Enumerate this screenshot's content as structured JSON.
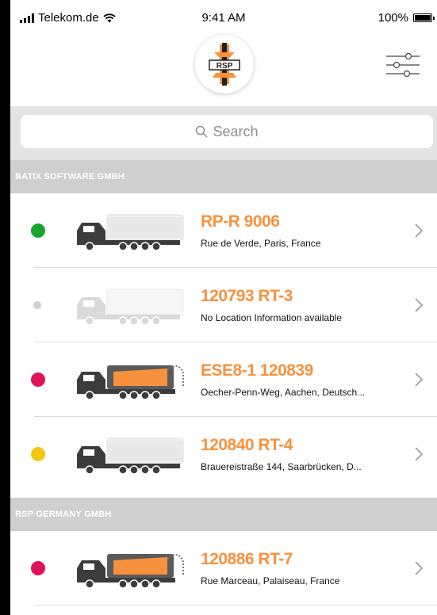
{
  "status_bar": {
    "carrier": "Telekom.de",
    "time": "9:41 AM",
    "battery": "100%"
  },
  "header": {
    "logo_text": "RSP",
    "filter_icon": "sliders-icon"
  },
  "search": {
    "placeholder": "Search",
    "icon": "magnifier-icon"
  },
  "colors": {
    "accent": "#f7913d",
    "online": "#17a52c",
    "offline": "#d1d1d1",
    "alert": "#e0135a",
    "warning": "#f2c80f"
  },
  "groups": [
    {
      "name": "BATIX SOFTWARE GMBH",
      "vehicles": [
        {
          "plate": "RP-R 9006",
          "location": "Rue de Verde, Paris, France",
          "status_color": "#17a52c"
        },
        {
          "plate": "120793 RT-3",
          "location": "No Location Information available",
          "status_color": "#d1d1d1"
        },
        {
          "plate": "ESE8-1 120839",
          "location": "Oecher-Penn-Weg, Aachen, Deutsch...",
          "status_color": "#e0135a"
        },
        {
          "plate": "120840 RT-4",
          "location": "Brauereistraße 144, Saarbrücken, D...",
          "status_color": "#f2c80f"
        }
      ]
    },
    {
      "name": "RSP GERMANY GMBH",
      "vehicles": [
        {
          "plate": "120886 RT-7",
          "location": "Rue Marceau, Palaiseau, France",
          "status_color": "#e0135a"
        }
      ]
    }
  ]
}
